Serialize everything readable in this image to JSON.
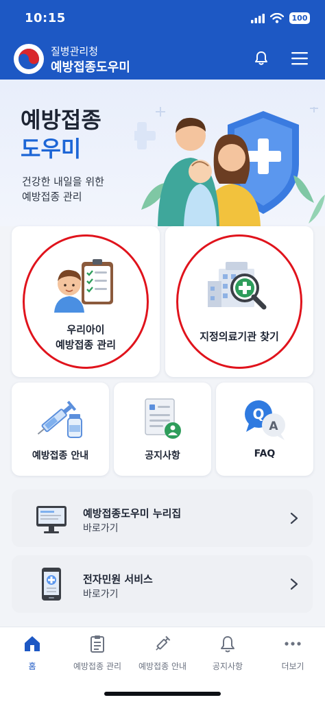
{
  "status_bar": {
    "time": "10:15",
    "battery": "100"
  },
  "app": {
    "subtitle": "질병관리청",
    "title": "예방접종도우미"
  },
  "hero": {
    "title_line1": "예방접종",
    "title_line2": "도우미",
    "desc_line1": "건강한 내일을 위한",
    "desc_line2": "예방접종 관리"
  },
  "main_cards": [
    {
      "label_line1": "우리아이",
      "label_line2": "예방접종 관리",
      "icon": "child-checklist-icon"
    },
    {
      "label": "지정의료기관 찾기",
      "icon": "hospital-search-icon"
    }
  ],
  "quick_cards": [
    {
      "label": "예방접종 안내",
      "icon": "syringe-vial-icon"
    },
    {
      "label": "공지사항",
      "icon": "notice-document-icon"
    },
    {
      "label": "FAQ",
      "icon": "qa-bubble-icon"
    }
  ],
  "link_rows": [
    {
      "title": "예방접종도우미 누리집",
      "subtitle": "바로가기",
      "icon": "monitor-icon"
    },
    {
      "title": "전자민원 서비스",
      "subtitle": "바로가기",
      "icon": "smartphone-icon"
    }
  ],
  "bottom_nav": [
    {
      "label": "홈",
      "icon": "home-icon",
      "active": true
    },
    {
      "label": "예방접종 관리",
      "icon": "clipboard-icon",
      "active": false
    },
    {
      "label": "예방접종 안내",
      "icon": "syringe-icon",
      "active": false
    },
    {
      "label": "공지사항",
      "icon": "bell-icon",
      "active": false
    },
    {
      "label": "더보기",
      "icon": "more-dots-icon",
      "active": false
    }
  ],
  "colors": {
    "primary": "#1d58c4",
    "accent_blue": "#1d66d6",
    "highlight_ring": "#e0131c",
    "green": "#2e9d5b"
  }
}
